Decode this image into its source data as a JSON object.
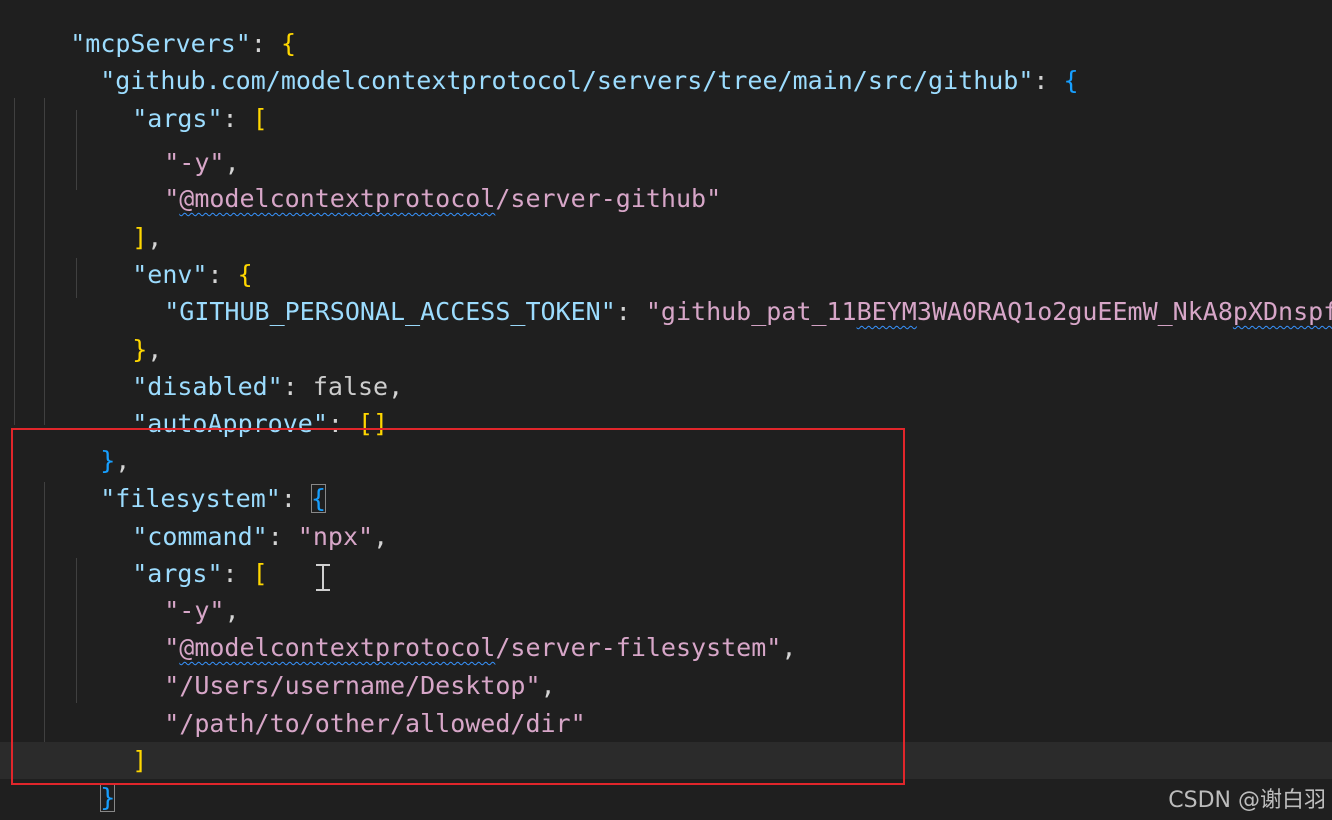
{
  "code": {
    "line1_key": "\"mcpServers\"",
    "line2_key": "\"github.com/modelcontextprotocol/servers/tree/main/src/github\"",
    "args_key": "\"args\"",
    "arg_y": "\"-y\"",
    "pkg_github_at": "\"",
    "pkg_github_squig": "@modelcontextprotocol",
    "pkg_github_rest": "/server-github\"",
    "env_key": "\"env\"",
    "token_key": "\"GITHUB_PERSONAL_ACCESS_TOKEN\"",
    "token_val_a": "\"github_pat_11",
    "token_val_b": "BEYM",
    "token_val_c": "3WA0RAQ1o2guEEmW_NkA8",
    "token_val_d": "pXDnspfBnSx",
    "disabled_key": "\"disabled\"",
    "false_val": "false",
    "autoapprove_key": "\"autoApprove\"",
    "filesystem_key": "\"filesystem\"",
    "command_key": "\"command\"",
    "command_val": "\"npx\"",
    "pkg_fs_at": "\"",
    "pkg_fs_squig": "@modelcontextprotocol",
    "pkg_fs_rest": "/server-filesystem\"",
    "path1": "\"/Users/username/Desktop\"",
    "path2": "\"/path/to/other/allowed/dir\""
  },
  "watermark": "CSDN @谢白羽",
  "colors": {
    "background": "#1f1f1f",
    "highlight_box": "#e0262b",
    "string": "#ce9178",
    "key": "#9cdcfe"
  }
}
